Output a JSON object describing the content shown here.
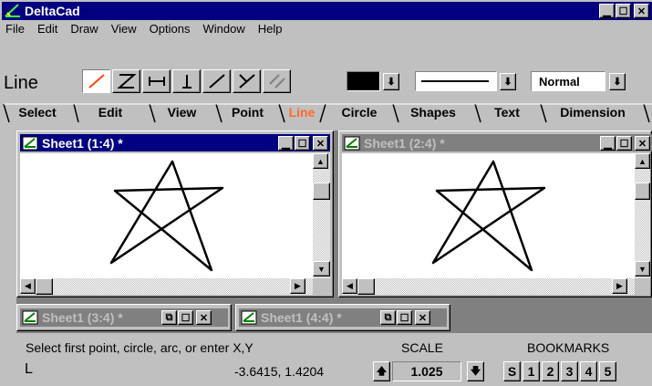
{
  "app": {
    "title": "DeltaCad"
  },
  "menu": [
    "File",
    "Edit",
    "Draw",
    "View",
    "Options",
    "Window",
    "Help"
  ],
  "toolbar": {
    "mode_label": "Line",
    "line_style_label": "Normal"
  },
  "tabs": [
    "Select",
    "Edit",
    "View",
    "Point",
    "Line",
    "Circle",
    "Shapes",
    "Text",
    "Dimension"
  ],
  "active_tab": "Line",
  "colors": {
    "active_tab_text": "#ff6a2a",
    "titlebar_active": "#000080",
    "titlebar_inactive": "#808080",
    "selected_tool_line": "#ff4500"
  },
  "sheets": {
    "sheet1": "Sheet1 (1:4) *",
    "sheet2": "Sheet1 (2:4) *",
    "sheet3": "Sheet1 (3:4) *",
    "sheet4": "Sheet1 (4:4) *"
  },
  "status": {
    "prompt": "Select first point, circle, arc, or enter X,Y",
    "cursor_mark": "L",
    "coordinates": "-3.6415, 1.4204",
    "scale_label": "SCALE",
    "scale_value": "1.025",
    "bookmarks_label": "BOOKMARKS",
    "bookmarks": [
      "S",
      "1",
      "2",
      "3",
      "4",
      "5"
    ]
  }
}
